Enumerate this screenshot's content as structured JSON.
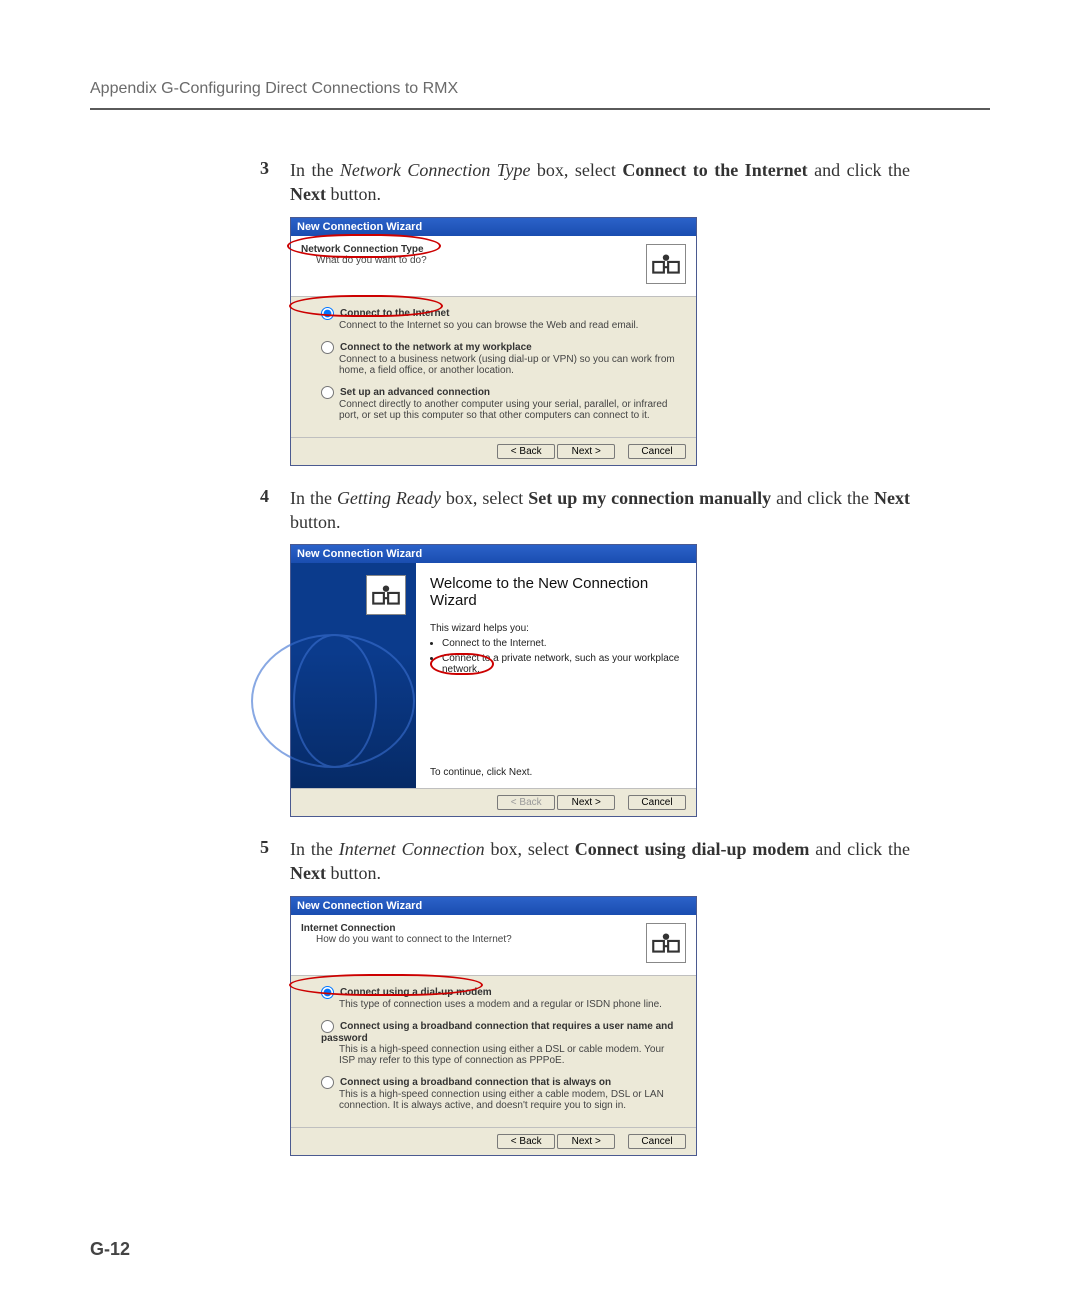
{
  "header": "Appendix G-Configuring Direct Connections to RMX",
  "page_number": "G-12",
  "steps": [
    {
      "num": "3",
      "pre": "In the ",
      "italic": "Network Connection Type",
      "mid": " box, select ",
      "bold": "Connect to the Internet",
      "post": " and click the ",
      "bold2": "Next",
      "post2": " button."
    },
    {
      "num": "4",
      "pre": "In the ",
      "italic": "Getting Ready",
      "mid": " box, select ",
      "bold": "Set up my connection manually",
      "post": " and click the ",
      "bold2": "Next",
      "post2": " button."
    },
    {
      "num": "5",
      "pre": "In the ",
      "italic": "Internet Connection",
      "mid": " box, select ",
      "bold": "Connect using dial-up modem",
      "post": " and click the ",
      "bold2": "Next",
      "post2": " button."
    }
  ],
  "wizard_common": {
    "titlebar": "New Connection Wizard",
    "back": "< Back",
    "next": "Next >",
    "cancel": "Cancel"
  },
  "wiz1": {
    "title": "Network Connection Type",
    "sub": "What do you want to do?",
    "options": [
      {
        "title": "Connect to the Internet",
        "desc": "Connect to the Internet so you can browse the Web and read email."
      },
      {
        "title": "Connect to the network at my workplace",
        "desc": "Connect to a business network (using dial-up or VPN) so you can work from home, a field office, or another location."
      },
      {
        "title": "Set up an advanced connection",
        "desc": "Connect directly to another computer using your serial, parallel, or infrared port, or set up this computer so that other computers can connect to it."
      }
    ]
  },
  "wiz2": {
    "welcome": "Welcome to the New Connection Wizard",
    "helps": "This wizard helps you:",
    "bullets": [
      "Connect to the Internet.",
      "Connect to a private network, such as your workplace network."
    ],
    "continue": "To continue, click Next."
  },
  "wiz3": {
    "title": "Internet Connection",
    "sub": "How do you want to connect to the Internet?",
    "options": [
      {
        "title": "Connect using a dial-up modem",
        "desc": "This type of connection uses a modem and a regular or ISDN phone line."
      },
      {
        "title": "Connect using a broadband connection that requires a user name and password",
        "desc": "This is a high-speed connection using either a DSL or cable modem. Your ISP may refer to this type of connection as PPPoE."
      },
      {
        "title": "Connect using a broadband connection that is always on",
        "desc": "This is a high-speed connection using either a cable modem, DSL or LAN connection. It is always active, and doesn't require you to sign in."
      }
    ]
  }
}
